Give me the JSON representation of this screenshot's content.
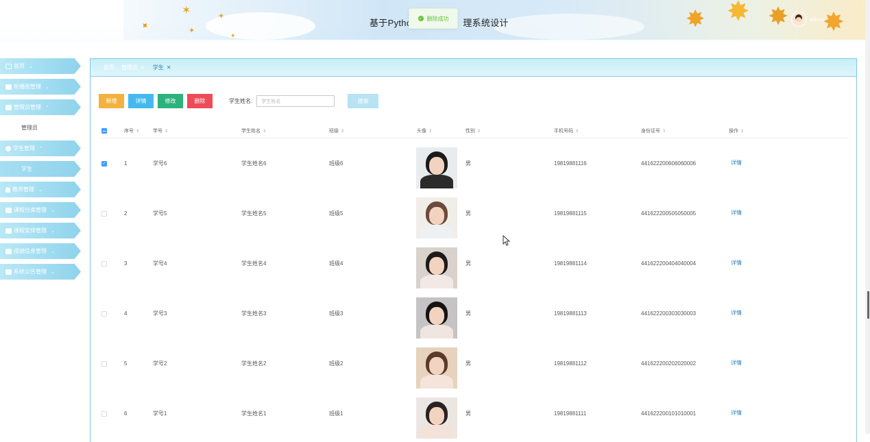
{
  "header": {
    "title": "基于Pytho",
    "title_tail": "理系统设计",
    "toast": "删除成功",
    "user": "admin"
  },
  "sidebar": {
    "items": [
      {
        "label": "首页",
        "icon": "home-icon"
      },
      {
        "label": "轮播图管理",
        "icon": "image-icon"
      },
      {
        "label": "管理员管理",
        "icon": "admin-icon",
        "expanded": true,
        "children": [
          "管理员"
        ]
      },
      {
        "label": "学生管理",
        "icon": "user-icon",
        "expanded": true,
        "children": [
          "学生"
        ]
      },
      {
        "label": "教师管理",
        "icon": "person-icon"
      },
      {
        "label": "课程分类管理",
        "icon": "category-icon"
      },
      {
        "label": "课程安排管理",
        "icon": "schedule-icon"
      },
      {
        "label": "成绩信息管理",
        "icon": "grade-icon"
      },
      {
        "label": "系统公告管理",
        "icon": "notice-icon"
      }
    ]
  },
  "breadcrumb": {
    "home": "首页",
    "second": "管理员",
    "current": "学生"
  },
  "toolbar": {
    "add": "新增",
    "detail": "详情",
    "edit": "修改",
    "delete": "删除",
    "search_label": "学生姓名:",
    "search_placeholder": "学生姓名",
    "search_button": "搜索"
  },
  "table": {
    "columns": [
      "序号",
      "学号",
      "学生姓名",
      "班级",
      "头像",
      "性别",
      "手机号码",
      "身份证号",
      "操作"
    ],
    "rows": [
      {
        "index": "1",
        "student_no": "学号6",
        "name": "学生姓名6",
        "class": "班级6",
        "gender": "男",
        "phone": "19819881116",
        "id_card": "441622200606060006",
        "action": "详情",
        "checked": true
      },
      {
        "index": "2",
        "student_no": "学号5",
        "name": "学生姓名5",
        "class": "班级5",
        "gender": "男",
        "phone": "19819881115",
        "id_card": "441622200505050005",
        "action": "详情",
        "checked": false
      },
      {
        "index": "3",
        "student_no": "学号4",
        "name": "学生姓名4",
        "class": "班级4",
        "gender": "男",
        "phone": "19819881114",
        "id_card": "441622200404040004",
        "action": "详情",
        "checked": false
      },
      {
        "index": "4",
        "student_no": "学号3",
        "name": "学生姓名3",
        "class": "班级3",
        "gender": "男",
        "phone": "19819881113",
        "id_card": "441622200303030003",
        "action": "详情",
        "checked": false
      },
      {
        "index": "5",
        "student_no": "学号2",
        "name": "学生姓名2",
        "class": "班级2",
        "gender": "男",
        "phone": "19819881112",
        "id_card": "441622200202020002",
        "action": "详情",
        "checked": false
      },
      {
        "index": "6",
        "student_no": "学号1",
        "name": "学生姓名1",
        "class": "班级1",
        "gender": "男",
        "phone": "19819881111",
        "id_card": "441622200101010001",
        "action": "详情",
        "checked": false
      }
    ]
  },
  "colors": {
    "add": "#f3b240",
    "detail": "#45b9ef",
    "edit": "#2db27c",
    "delete": "#ef4a57",
    "accent": "#8fd3ec",
    "link": "#2d7fb8"
  }
}
